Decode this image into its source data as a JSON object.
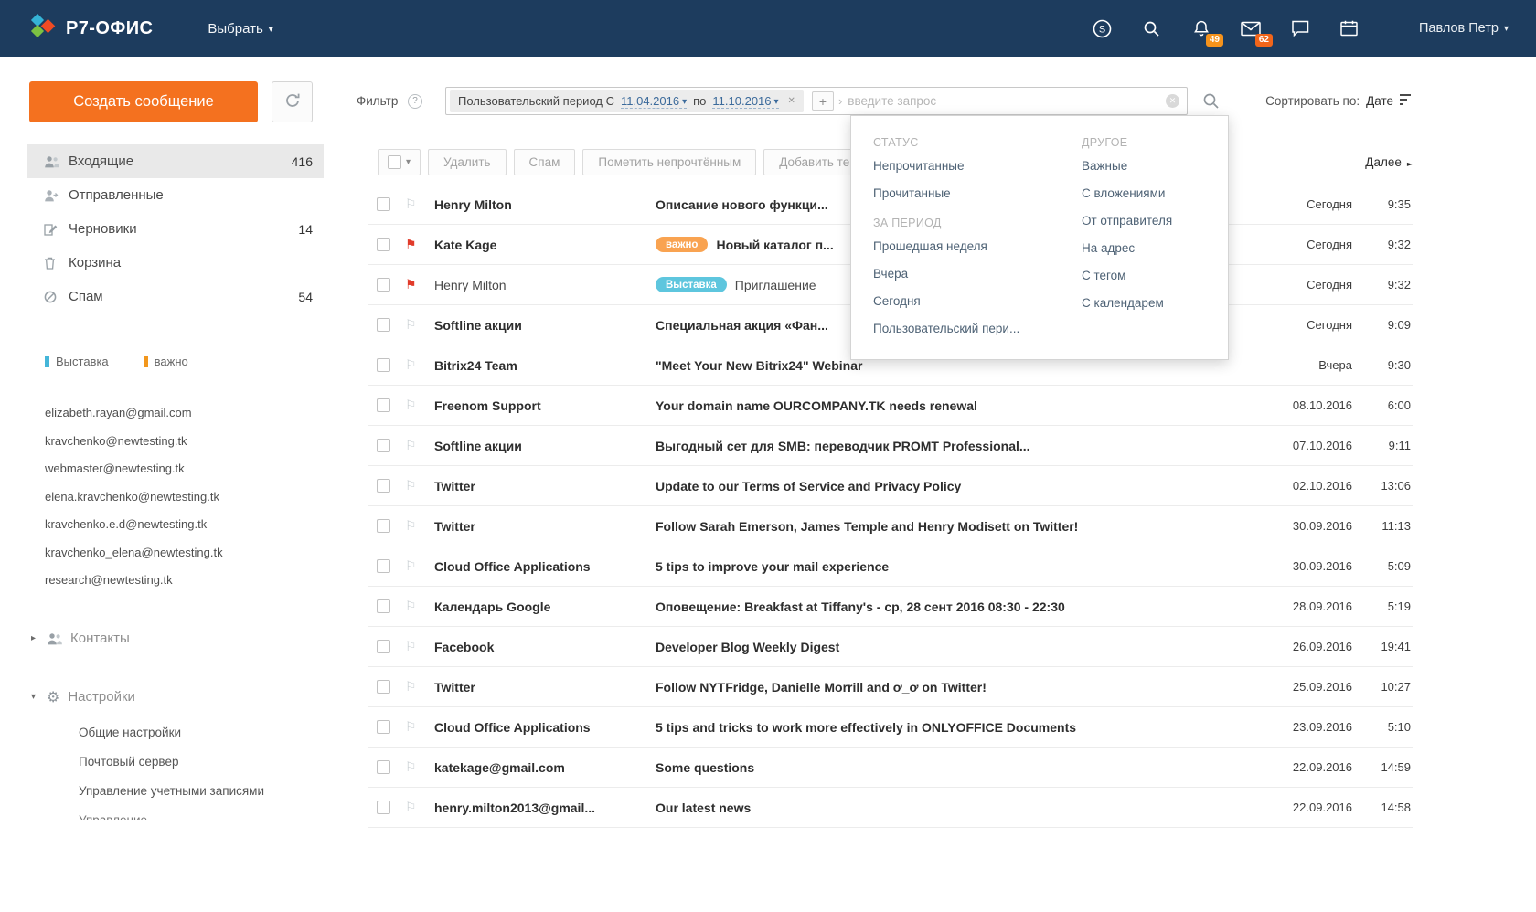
{
  "topbar": {
    "brand": "Р7-ОФИС",
    "select_label": "Выбрать",
    "user_name": "Павлов Петр",
    "feed_badge": "49",
    "mail_badge": "62",
    "icons": [
      "s-circle-icon",
      "search-icon",
      "feed-icon",
      "mail-icon",
      "chat-icon",
      "calendar-icon"
    ]
  },
  "sidebar": {
    "compose_label": "Создать сообщение",
    "folders": [
      {
        "label": "Входящие",
        "count": "416",
        "icon": "inbox-icon",
        "selected": true
      },
      {
        "label": "Отправленные",
        "count": "",
        "icon": "sent-icon",
        "selected": false
      },
      {
        "label": "Черновики",
        "count": "14",
        "icon": "drafts-icon",
        "selected": false
      },
      {
        "label": "Корзина",
        "count": "",
        "icon": "trash-icon",
        "selected": false
      },
      {
        "label": "Спам",
        "count": "54",
        "icon": "spam-icon",
        "selected": false
      }
    ],
    "tags": [
      {
        "label": "Выставка",
        "color": "#45b6d9"
      },
      {
        "label": "важно",
        "color": "#f2971d"
      }
    ],
    "addresses": [
      "elizabeth.rayan@gmail.com",
      "kravchenko@newtesting.tk",
      "webmaster@newtesting.tk",
      "elena.kravchenko@newtesting.tk",
      "kravchenko.e.d@newtesting.tk",
      "kravchenko_elena@newtesting.tk",
      "research@newtesting.tk"
    ],
    "contacts_label": "Контакты",
    "settings_label": "Настройки",
    "settings_items": [
      "Общие настройки",
      "Почтовый сервер",
      "Управление учетными записями",
      "Управление ..."
    ]
  },
  "filter": {
    "label": "Фильтр",
    "chip_text": "Пользовательский период С",
    "date_from": "11.04.2016",
    "between_label": "по",
    "date_to": "11.10.2016",
    "add_label": "+",
    "query_placeholder": "введите запрос",
    "sort_label": "Сортировать по:",
    "sort_value": "Дате"
  },
  "toolbar": {
    "buttons": [
      "Удалить",
      "Спам",
      "Пометить непрочтённым",
      "Добавить тег"
    ],
    "next_label": "Далее"
  },
  "dropdown": {
    "columns": [
      {
        "sections": [
          {
            "title": "СТАТУС",
            "items": [
              "Непрочитанные",
              "Прочитанные"
            ]
          },
          {
            "title": "ЗА ПЕРИОД",
            "items": [
              "Прошедшая неделя",
              "Вчера",
              "Сегодня",
              "Пользовательский пери..."
            ]
          }
        ]
      },
      {
        "sections": [
          {
            "title": "ДРУГОЕ",
            "items": [
              "Важные",
              "С вложениями",
              "От отправителя",
              "На адрес",
              "С тегом",
              "С календарем"
            ]
          }
        ]
      }
    ]
  },
  "emails": [
    {
      "sender": "Henry Milton",
      "subject": "Описание нового функци...",
      "flagged": false,
      "unread": true,
      "date": "Сегодня",
      "time": "9:35"
    },
    {
      "sender": "Kate Kage",
      "tag": {
        "label": "важно",
        "color": "#f9a351"
      },
      "subject": "Новый каталог п...",
      "flagged": true,
      "unread": true,
      "date": "Сегодня",
      "time": "9:32"
    },
    {
      "sender": "Henry Milton",
      "tag": {
        "label": "Выставка",
        "color": "#5ec6de"
      },
      "subject": "Приглашение",
      "flagged": true,
      "unread": false,
      "date": "Сегодня",
      "time": "9:32"
    },
    {
      "sender": "Softline акции",
      "subject": "Специальная акция «Фан...",
      "flagged": false,
      "unread": true,
      "date": "Сегодня",
      "time": "9:09"
    },
    {
      "sender": "Bitrix24 Team",
      "subject": "\"Meet Your New Bitrix24\" Webinar",
      "flagged": false,
      "unread": true,
      "date": "Вчера",
      "time": "9:30"
    },
    {
      "sender": "Freenom Support",
      "subject": "Your domain name OURCOMPANY.TK needs renewal",
      "flagged": false,
      "unread": true,
      "date": "08.10.2016",
      "time": "6:00"
    },
    {
      "sender": "Softline акции",
      "subject": "Выгодный сет для SMB: переводчик PROMT Professional...",
      "flagged": false,
      "unread": true,
      "date": "07.10.2016",
      "time": "9:11"
    },
    {
      "sender": "Twitter",
      "subject": "Update to our Terms of Service and Privacy Policy",
      "flagged": false,
      "unread": true,
      "date": "02.10.2016",
      "time": "13:06"
    },
    {
      "sender": "Twitter",
      "subject": "Follow Sarah Emerson, James Temple and Henry Modisett on Twitter!",
      "flagged": false,
      "unread": true,
      "date": "30.09.2016",
      "time": "11:13"
    },
    {
      "sender": "Cloud Office Applications",
      "subject": "5 tips to improve your mail experience",
      "flagged": false,
      "unread": true,
      "date": "30.09.2016",
      "time": "5:09"
    },
    {
      "sender": "Календарь Google",
      "subject": "Оповещение: Breakfast at Tiffany's - ср, 28 сент 2016 08:30 - 22:30",
      "flagged": false,
      "unread": true,
      "date": "28.09.2016",
      "time": "5:19"
    },
    {
      "sender": "Facebook",
      "subject": "Developer Blog Weekly Digest",
      "flagged": false,
      "unread": true,
      "date": "26.09.2016",
      "time": "19:41"
    },
    {
      "sender": "Twitter",
      "subject": "Follow NYTFridge, Danielle Morrill and ơ_ơ on Twitter!",
      "flagged": false,
      "unread": true,
      "date": "25.09.2016",
      "time": "10:27"
    },
    {
      "sender": "Cloud Office Applications",
      "subject": "5 tips and tricks to work more effectively in ONLYOFFICE Documents",
      "flagged": false,
      "unread": true,
      "date": "23.09.2016",
      "time": "5:10"
    },
    {
      "sender": "katekage@gmail.com",
      "subject": "Some questions",
      "flagged": false,
      "unread": true,
      "date": "22.09.2016",
      "time": "14:59"
    },
    {
      "sender": "henry.milton2013@gmail...",
      "subject": "Our latest news",
      "flagged": false,
      "unread": true,
      "date": "22.09.2016",
      "time": "14:58"
    }
  ]
}
